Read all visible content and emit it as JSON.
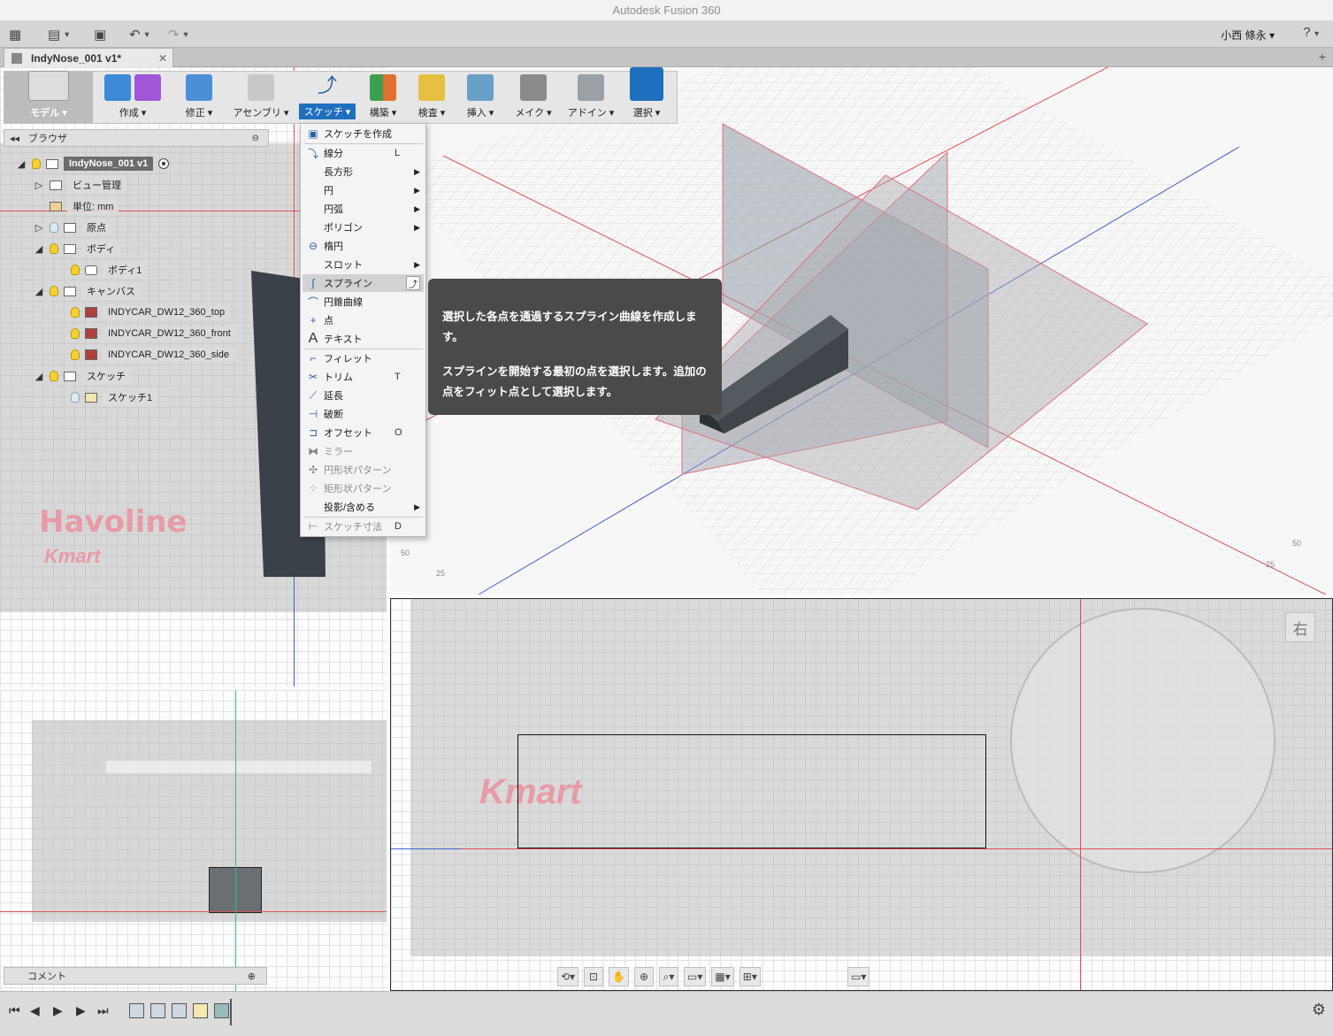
{
  "window": {
    "title": "Autodesk Fusion 360"
  },
  "quick_access": {
    "user": "小西 條永 ▾",
    "help": "?"
  },
  "document_tab": {
    "title": "IndyNose_001 v1*",
    "close": "✕",
    "new_tab": "+"
  },
  "toolbar": {
    "groups": [
      {
        "label": "モデル ▾"
      },
      {
        "label": "作成 ▾"
      },
      {
        "label": "修正 ▾"
      },
      {
        "label": "アセンブリ ▾"
      },
      {
        "label": "スケッチ ▾"
      },
      {
        "label": "構築 ▾"
      },
      {
        "label": "検査 ▾"
      },
      {
        "label": "挿入 ▾"
      },
      {
        "label": "メイク ▾"
      },
      {
        "label": "アドイン ▾"
      },
      {
        "label": "選択 ▾"
      }
    ]
  },
  "browser": {
    "title": "ブラウザ",
    "nodes": [
      {
        "label": "IndyNose_001 v1"
      },
      {
        "label": "ビュー管理"
      },
      {
        "label": "単位: mm"
      },
      {
        "label": "原点"
      },
      {
        "label": "ボディ"
      },
      {
        "label": "ボディ1"
      },
      {
        "label": "キャンバス"
      },
      {
        "label": "INDYCAR_DW12_360_top"
      },
      {
        "label": "INDYCAR_DW12_360_front"
      },
      {
        "label": "INDYCAR_DW12_360_side"
      },
      {
        "label": "スケッチ"
      },
      {
        "label": "スケッチ1"
      }
    ]
  },
  "sketch_menu": {
    "items": [
      {
        "label": "スケッチを作成",
        "shortcut": ""
      },
      {
        "label": "線分",
        "shortcut": "L"
      },
      {
        "label": "長方形",
        "shortcut": ""
      },
      {
        "label": "円",
        "shortcut": ""
      },
      {
        "label": "円弧",
        "shortcut": ""
      },
      {
        "label": "ポリゴン",
        "shortcut": ""
      },
      {
        "label": "楕円",
        "shortcut": ""
      },
      {
        "label": "スロット",
        "shortcut": ""
      },
      {
        "label": "スプライン",
        "shortcut": ""
      },
      {
        "label": "円錐曲線",
        "shortcut": ""
      },
      {
        "label": "点",
        "shortcut": ""
      },
      {
        "label": "テキスト",
        "shortcut": ""
      },
      {
        "label": "フィレット",
        "shortcut": ""
      },
      {
        "label": "トリム",
        "shortcut": "T"
      },
      {
        "label": "延長",
        "shortcut": ""
      },
      {
        "label": "破断",
        "shortcut": ""
      },
      {
        "label": "オフセット",
        "shortcut": "O"
      },
      {
        "label": "ミラー",
        "shortcut": ""
      },
      {
        "label": "円形状パターン",
        "shortcut": ""
      },
      {
        "label": "矩形状パターン",
        "shortcut": ""
      },
      {
        "label": "投影/含める",
        "shortcut": ""
      },
      {
        "label": "スケッチ寸法",
        "shortcut": "D"
      }
    ]
  },
  "tooltip": {
    "line1": "選択した各点を通過するスプライン曲線を作成します。",
    "line2": "スプラインを開始する最初の点を選択します。追加の点をフィット点として選択します。"
  },
  "canvas_text": {
    "havoline": "Havoline",
    "kmart": "Kmart",
    "view_cube": "右",
    "axis_ticks": [
      "50",
      "25",
      "50",
      "25"
    ]
  },
  "comment_panel": {
    "label": "コメント"
  },
  "colors": {
    "accent": "#1f6fbf",
    "axis_red": "#e05050",
    "axis_green": "#2dbd8f",
    "axis_blue": "#4060d0",
    "tooltip_bg": "#4a4a4a"
  }
}
